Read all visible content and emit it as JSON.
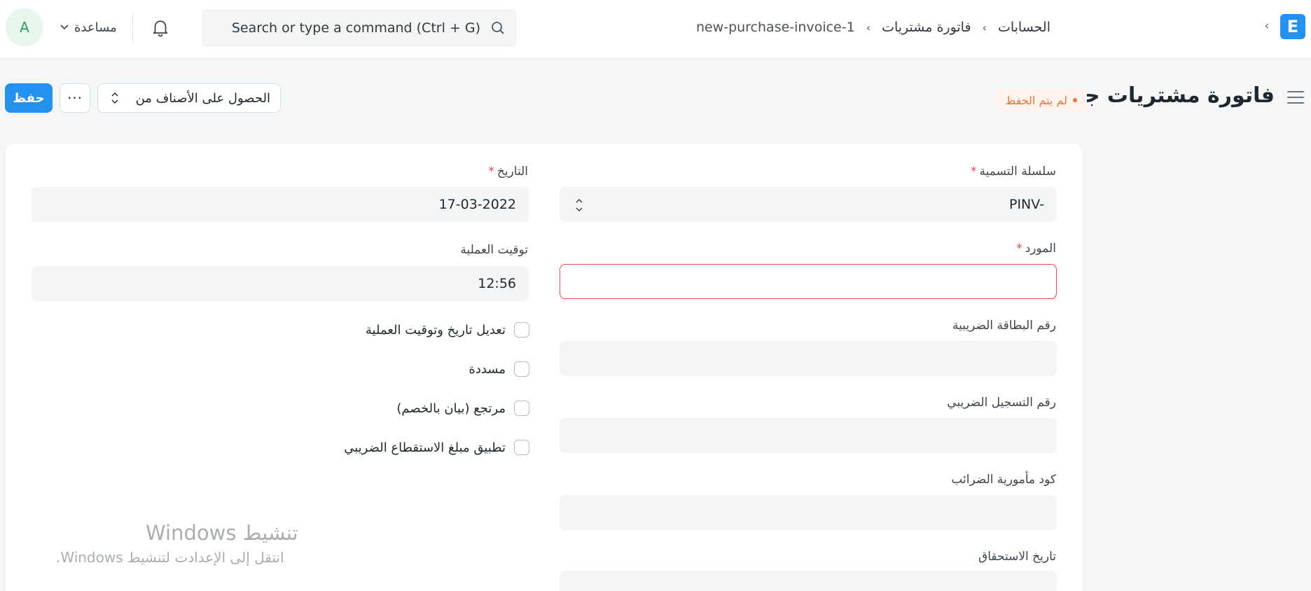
{
  "navbar": {
    "avatar_initial": "A",
    "help_label": "مساعدة",
    "search_placeholder": "Search or type a command (Ctrl + G)",
    "breadcrumb": [
      "الحسابات",
      "فاتورة مشتريات",
      "new-purchase-invoice-1"
    ],
    "logo_letter": "E"
  },
  "page": {
    "title": "فاتورة مشتريات جديد",
    "status": "لم يتم الحفظ",
    "save_label": "حفظ",
    "more_label": "···",
    "get_items_label": "الحصول على الأصناف من"
  },
  "form": {
    "naming_series": {
      "label": "سلسلة التسمية",
      "value": "PINV-"
    },
    "supplier": {
      "label": "المورد",
      "value": ""
    },
    "tax_id": {
      "label": "رقم البطاقة الضريبية",
      "value": ""
    },
    "tax_registration": {
      "label": "رقم التسجيل الضريبي",
      "value": ""
    },
    "tax_office_code": {
      "label": "كود مأمورية الضرائب",
      "value": ""
    },
    "due_date": {
      "label": "تاريخ الاستحقاق",
      "value": ""
    },
    "posting_date": {
      "label": "التاريخ",
      "value": "17-03-2022"
    },
    "posting_time": {
      "label": "توقيت العملية",
      "value": "12:56"
    },
    "checks": [
      {
        "label": "تعديل تاريخ وتوقيت العملية",
        "checked": false
      },
      {
        "label": "مسددة",
        "checked": false
      },
      {
        "label": "مرتجع (بيان بالخصم)",
        "checked": false
      },
      {
        "label": "تطبيق مبلغ الاستقطاع الضريبي",
        "checked": false
      }
    ],
    "required_marker": "*"
  },
  "watermark": {
    "line1": "تنشيط Windows",
    "line2": "انتقل إلى الإعدادت لتنشيط Windows."
  },
  "colors": {
    "primary": "#2490ef",
    "error_border": "#e24c4c",
    "status_text": "#e8743a",
    "status_bg": "#fff5ee"
  }
}
